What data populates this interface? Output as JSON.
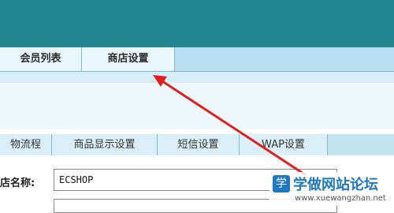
{
  "tabs": {
    "top": [
      {
        "label": "会员列表"
      },
      {
        "label": "商店设置"
      }
    ]
  },
  "subtabs": [
    {
      "label": "物流程"
    },
    {
      "label": "商品显示设置"
    },
    {
      "label": "短信设置"
    },
    {
      "label": "WAP设置"
    }
  ],
  "form": {
    "shop_name_label": "店名称:",
    "shop_name_value": "ECSHOP"
  },
  "watermark": {
    "logo_char": "学",
    "title": "学做网站论坛",
    "url": "www.xuewangzhan.net"
  },
  "colors": {
    "header": "#23858f",
    "tab_bar": "#b8dff0",
    "arrow": "#e02020",
    "watermark_blue": "#1f78c1"
  }
}
